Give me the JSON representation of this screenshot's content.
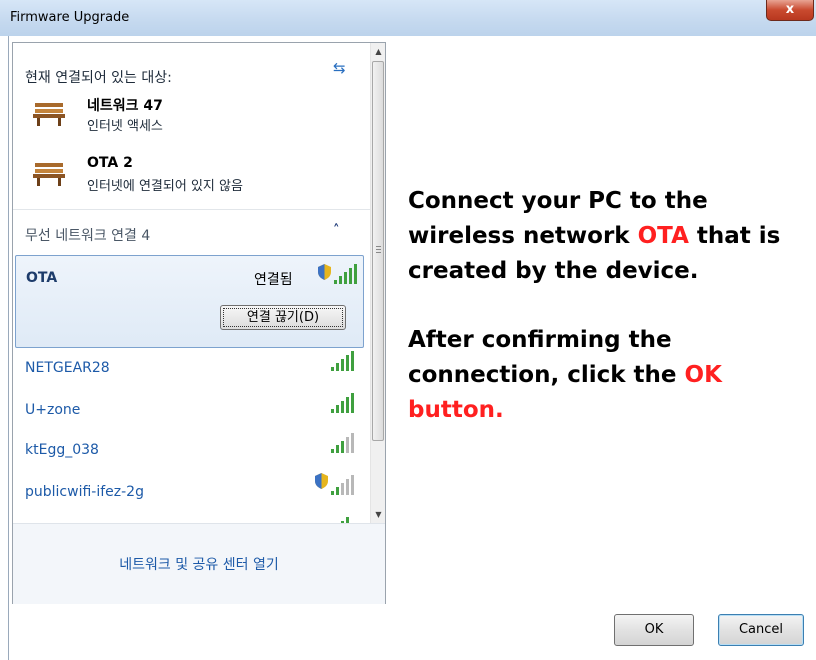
{
  "window": {
    "title": "Firmware Upgrade",
    "close_label": "x"
  },
  "flyout": {
    "connected_header": "현재 연결되어 있는 대상:",
    "connections": [
      {
        "name": "네트워크 47",
        "status": "인터넷 액세스"
      },
      {
        "name": "OTA 2",
        "status": "인터넷에 연결되어 있지 않음"
      }
    ],
    "section_header": "무선 네트워크 연결 4",
    "selected_network": {
      "name": "OTA",
      "status": "연결됨",
      "disconnect_label": "연결 끊기(D)"
    },
    "networks": [
      {
        "name": "NETGEAR28"
      },
      {
        "name": "U+zone"
      },
      {
        "name": "ktEgg_038"
      },
      {
        "name": "publicwifi-ifez-2g"
      }
    ],
    "footer_link": "네트워크 및 공유 센터 열기"
  },
  "instructions": {
    "line1_pre": "Connect your PC to the wireless network ",
    "line1_highlight": "OTA",
    "line1_post": " that is created by the device.",
    "line2_pre": "After confirming the connection, click the ",
    "line2_highlight": "OK",
    "line2_post": " button."
  },
  "buttons": {
    "ok": "OK",
    "cancel": "Cancel"
  },
  "colors": {
    "highlight": "#ff2020",
    "link": "#1d5aa8",
    "signal": "#3fa03f"
  }
}
